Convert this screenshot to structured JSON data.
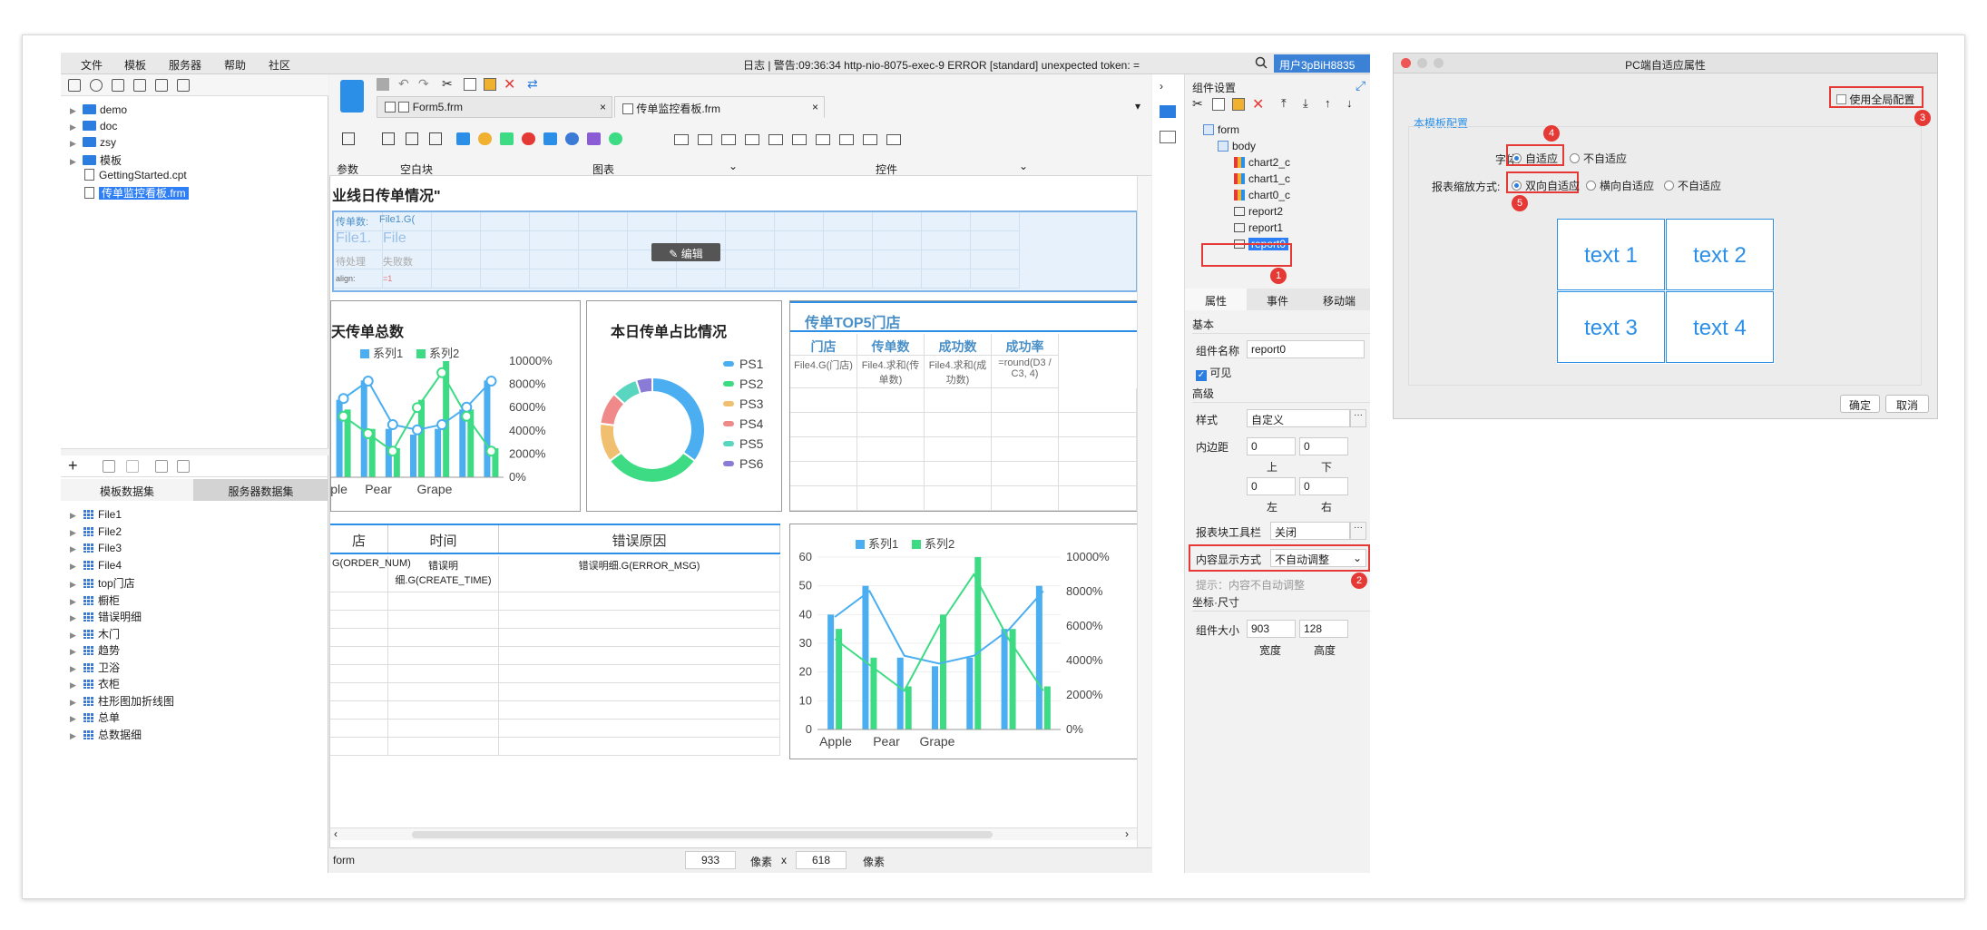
{
  "menu": [
    "文件",
    "模板",
    "服务器",
    "帮助",
    "社区"
  ],
  "log_text": "日志 | 警告:09:36:34 http-nio-8075-exec-9 ERROR [standard] unexpected token: =",
  "user": "用户3pBiH8835",
  "file_tree": [
    {
      "label": "demo",
      "type": "folder"
    },
    {
      "label": "doc",
      "type": "folder"
    },
    {
      "label": "zsy",
      "type": "folder"
    },
    {
      "label": "模板",
      "type": "folder"
    },
    {
      "label": "GettingStarted.cpt",
      "type": "file"
    },
    {
      "label": "传单监控看板.frm",
      "type": "file",
      "selected": true
    }
  ],
  "dataset_tabs": [
    "模板数据集",
    "服务器数据集"
  ],
  "datasets": [
    "File1",
    "File2",
    "File3",
    "File4",
    "top门店",
    "橱柜",
    "错误明细",
    "木门",
    "趋势",
    "卫浴",
    "衣柜",
    "柱形图加折线图",
    "总单",
    "总数据细"
  ],
  "tabs": [
    "Form5.frm",
    "传单监控看板.frm"
  ],
  "toolbar_groups": [
    "参数",
    "空白块",
    "图表",
    "控件"
  ],
  "canvas": {
    "header": "业线日传单情况\"",
    "edit_label": "编辑",
    "report_cells": [
      "传单数:",
      "File1.G(",
      "File1.",
      "File",
      "待处理",
      "失败数",
      "align:",
      "=1"
    ],
    "widget_total_title": "天传单总数",
    "widget_pie_title": "本日传单占比情况",
    "widget_top5_title": "传单TOP5门店",
    "top5_headers": [
      "门店",
      "传单数",
      "成功数",
      "成功率"
    ],
    "top5_row": [
      "File4.G(门店)",
      "File4.求和(传单数)",
      "File4.求和(成功数)",
      "=round(D3 / C3, 4)"
    ],
    "error_headers": [
      "店",
      "时间",
      "错误原因"
    ],
    "error_row": [
      "G(ORDER_NUM)",
      "错误明细.G(CREATE_TIME)",
      "错误明细.G(ERROR_MSG)"
    ],
    "pie_legend": [
      "PS1",
      "PS2",
      "PS3",
      "PS4",
      "PS5",
      "PS6"
    ]
  },
  "chart_data": [
    {
      "type": "bar",
      "title": "",
      "categories": [
        "Apple",
        "Pear",
        "Grape"
      ],
      "series": [
        {
          "name": "系列1",
          "values": [
            40,
            50,
            25,
            22,
            25,
            35,
            50
          ]
        },
        {
          "name": "系列2",
          "values": [
            35,
            25,
            15,
            40,
            60,
            35,
            15
          ]
        }
      ],
      "y_left": [
        0,
        10,
        20,
        30,
        40,
        50,
        60
      ],
      "y_right": [
        "0%",
        "2000%",
        "4000%",
        "6000%",
        "8000%",
        "10000%"
      ],
      "legend": "top"
    },
    {
      "type": "pie",
      "title": "本日传单占比情况",
      "categories": [
        "PS1",
        "PS2",
        "PS3",
        "PS4",
        "PS5",
        "PS6"
      ],
      "values": [
        35,
        30,
        12,
        10,
        8,
        5
      ]
    }
  ],
  "status": {
    "label": "form",
    "width": "933",
    "height": "618",
    "unit": "像素",
    "x": "x"
  },
  "props": {
    "title": "组件设置",
    "tree": [
      "form",
      "body",
      "chart2_c",
      "chart1_c",
      "chart0_c",
      "report2",
      "report1",
      "report0"
    ],
    "tabs": [
      "属性",
      "事件",
      "移动端"
    ],
    "basic": "基本",
    "name_label": "组件名称",
    "name_value": "report0",
    "visible": "可见",
    "advanced": "高级",
    "style_label": "样式",
    "style_value": "自定义",
    "padding_label": "内边距",
    "pad_labels": [
      "上",
      "下",
      "左",
      "右"
    ],
    "pad_values": [
      "0",
      "0",
      "0",
      "0"
    ],
    "toolbar_label": "报表块工具栏",
    "toolbar_value": "关闭",
    "content_mode_label": "内容显示方式",
    "content_mode_value": "不自动调整",
    "hint": "提示：内容不自动调整",
    "coord_label": "坐标·尺寸",
    "size_label": "组件大小",
    "size_w": "903",
    "size_h": "128",
    "w_label": "宽度",
    "h_label": "高度"
  },
  "dialog": {
    "title": "PC端自适应属性",
    "global_cfg": "使用全局配置",
    "section": "本模板配置",
    "font_label": "字体:",
    "font_opts": [
      "自适应",
      "不自适应"
    ],
    "scale_label": "报表缩放方式:",
    "scale_opts": [
      "双向自适应",
      "横向自适应",
      "不自适应"
    ],
    "preview": [
      "text 1",
      "text 2",
      "text 3",
      "text 4"
    ],
    "ok": "确定",
    "cancel": "取消"
  },
  "badges": [
    "1",
    "2",
    "3",
    "4",
    "5"
  ],
  "colors": {
    "blue": "#4aaef0",
    "green": "#3ddc84",
    "accent": "#2b7ee0",
    "red": "#e53935"
  }
}
